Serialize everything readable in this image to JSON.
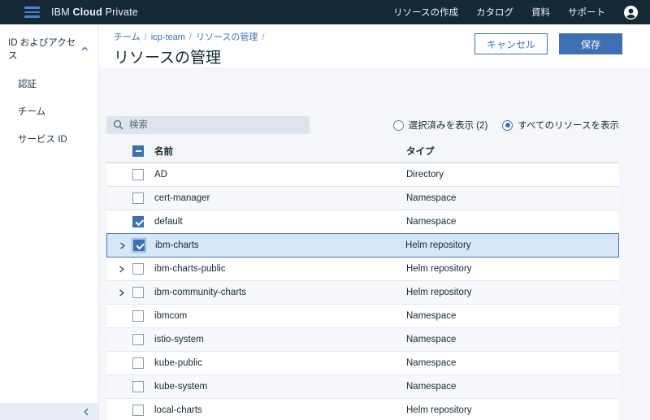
{
  "header": {
    "brand": {
      "ibm": "IBM",
      "cloud": "Cloud",
      "private": "Private"
    },
    "nav": [
      "リソースの作成",
      "カタログ",
      "資料",
      "サポート"
    ]
  },
  "sidebar": {
    "section": "ID およびアクセス",
    "items": [
      "認証",
      "チーム",
      "サービス ID"
    ]
  },
  "page": {
    "breadcrumb": [
      "チーム",
      "icp-team",
      "リソースの管理"
    ],
    "separator": "/",
    "title": "リソースの管理",
    "cancel_label": "キャンセル",
    "save_label": "保存"
  },
  "toolbar": {
    "search_placeholder": "検索",
    "radio_selected": "選択済みを表示 (2)",
    "radio_all": "すべてのリソースを表示",
    "radio_all_selected": true
  },
  "table": {
    "columns": [
      "名前",
      "タイプ"
    ],
    "rows": [
      {
        "name": "AD",
        "type": "Directory",
        "checked": false,
        "expandable": false,
        "highlighted": false
      },
      {
        "name": "cert-manager",
        "type": "Namespace",
        "checked": false,
        "expandable": false,
        "highlighted": false
      },
      {
        "name": "default",
        "type": "Namespace",
        "checked": true,
        "expandable": false,
        "highlighted": false
      },
      {
        "name": "ibm-charts",
        "type": "Helm repository",
        "checked": true,
        "expandable": true,
        "highlighted": true
      },
      {
        "name": "ibm-charts-public",
        "type": "Helm repository",
        "checked": false,
        "expandable": true,
        "highlighted": false
      },
      {
        "name": "ibm-community-charts",
        "type": "Helm repository",
        "checked": false,
        "expandable": true,
        "highlighted": false
      },
      {
        "name": "ibmcom",
        "type": "Namespace",
        "checked": false,
        "expandable": false,
        "highlighted": false
      },
      {
        "name": "istio-system",
        "type": "Namespace",
        "checked": false,
        "expandable": false,
        "highlighted": false
      },
      {
        "name": "kube-public",
        "type": "Namespace",
        "checked": false,
        "expandable": false,
        "highlighted": false
      },
      {
        "name": "kube-system",
        "type": "Namespace",
        "checked": false,
        "expandable": false,
        "highlighted": false
      },
      {
        "name": "local-charts",
        "type": "Helm repository",
        "checked": false,
        "expandable": false,
        "highlighted": false
      }
    ]
  },
  "icons": {
    "menu": "hamburger-menu-icon",
    "user": "user-avatar-icon",
    "search": "search-icon",
    "section_collapse": "chevron-up-icon",
    "sidebar_collapse": "chevron-left-icon",
    "row_expand": "chevron-right-icon"
  },
  "colors": {
    "header_bg": "#152935",
    "accent_blue": "#3d70b2",
    "hamburger_blue": "#4a82d9",
    "page_bg": "#f4f6fa",
    "row_highlight_bg": "#d8e7f8",
    "row_highlight_border": "#4178be",
    "zebra_row": "#f6f8fb"
  }
}
